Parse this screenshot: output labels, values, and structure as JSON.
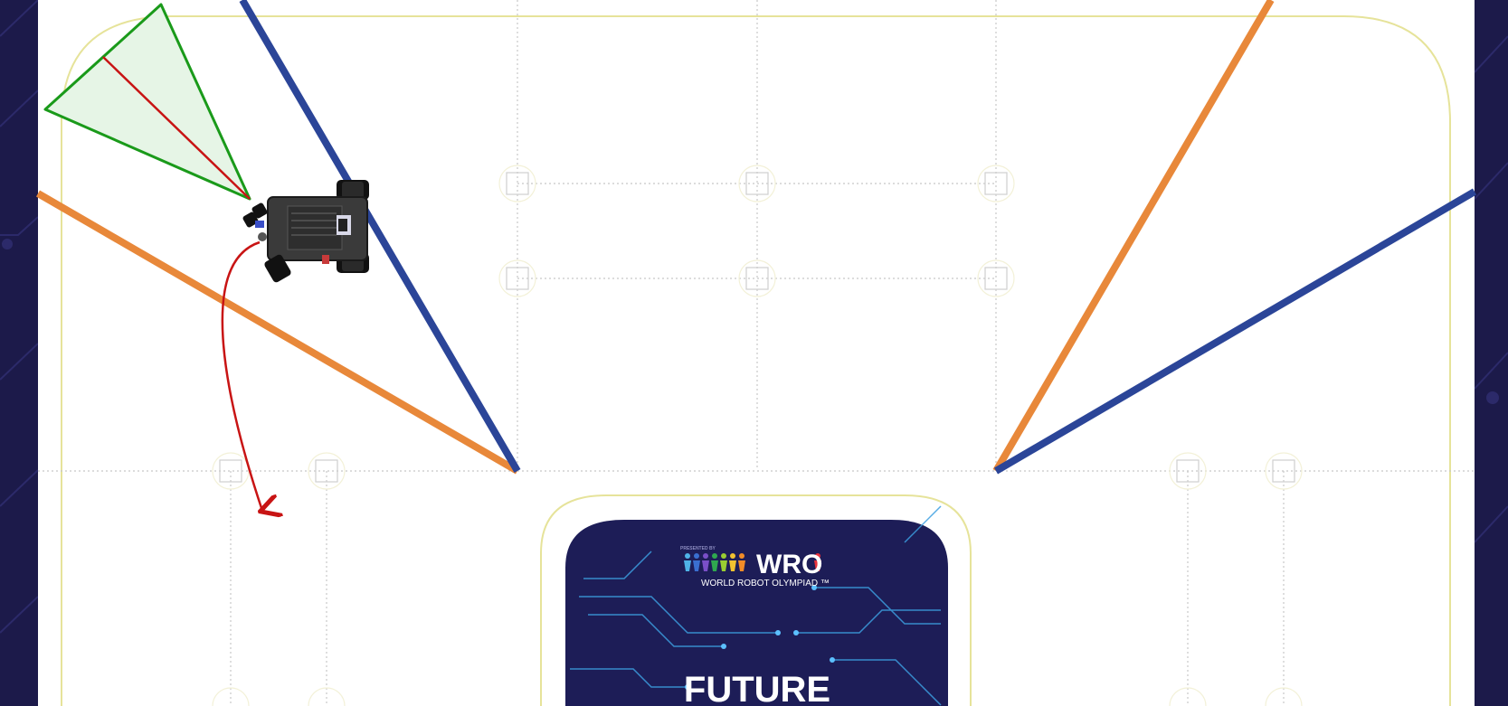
{
  "logo": {
    "presented_by": "PRESENTED BY",
    "brand": "WRO",
    "tagline": "WORLD ROBOT OLYMPIAD ™"
  },
  "center_panel": {
    "headline": "FUTURE"
  },
  "colors": {
    "background": "#1c1a4a",
    "mat": "#ffffff",
    "orange_line": "#e8883a",
    "blue_line": "#2b4598",
    "border_yellow": "#e6e39a",
    "sensor_green": "#1a9a1a",
    "path_red": "#c81414"
  }
}
